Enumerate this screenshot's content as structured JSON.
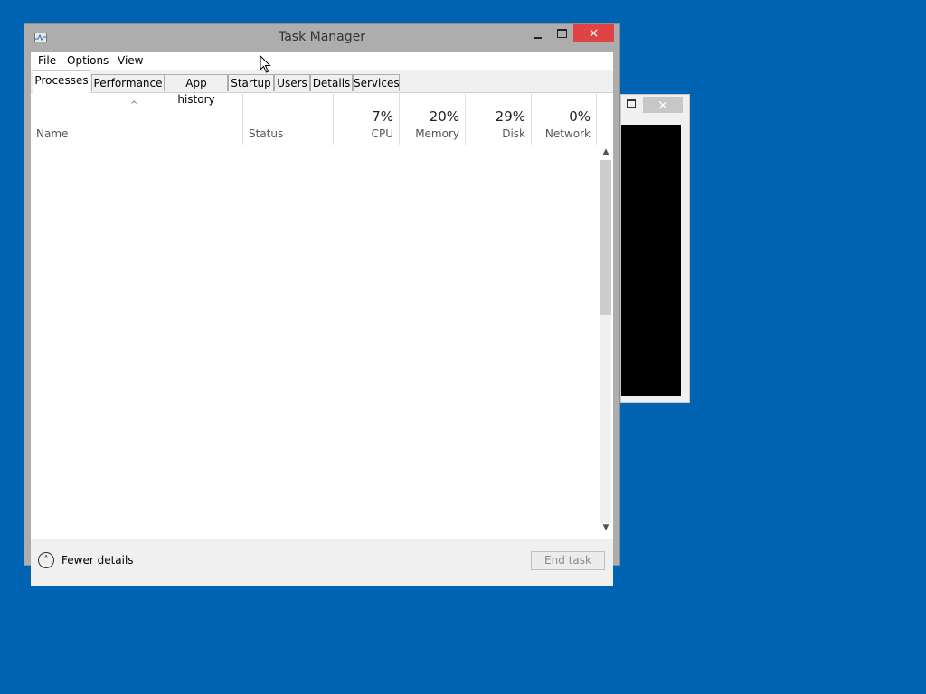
{
  "background_window": {
    "close_glyph": "×"
  },
  "window": {
    "title": "Task Manager",
    "minimize_icon": "minimize-icon",
    "maximize_icon": "maximize-icon",
    "close_glyph": "×"
  },
  "menu": {
    "items": [
      "File",
      "Options",
      "View"
    ]
  },
  "tabs": {
    "items": [
      "Processes",
      "Performance",
      "App history",
      "Startup",
      "Users",
      "Details",
      "Services"
    ],
    "active": "Processes"
  },
  "columns": {
    "name": {
      "label": "Name"
    },
    "status": {
      "label": "Status"
    },
    "cpu": {
      "label": "CPU",
      "value": "7%"
    },
    "memory": {
      "label": "Memory",
      "value": "20%"
    },
    "disk": {
      "label": "Disk",
      "value": "29%"
    },
    "network": {
      "label": "Network",
      "value": "0%"
    }
  },
  "footer": {
    "fewer_details_label": "Fewer details",
    "end_task_label": "End task"
  },
  "colors": {
    "desktop": "#0063b1",
    "close_button": "#e04343"
  }
}
